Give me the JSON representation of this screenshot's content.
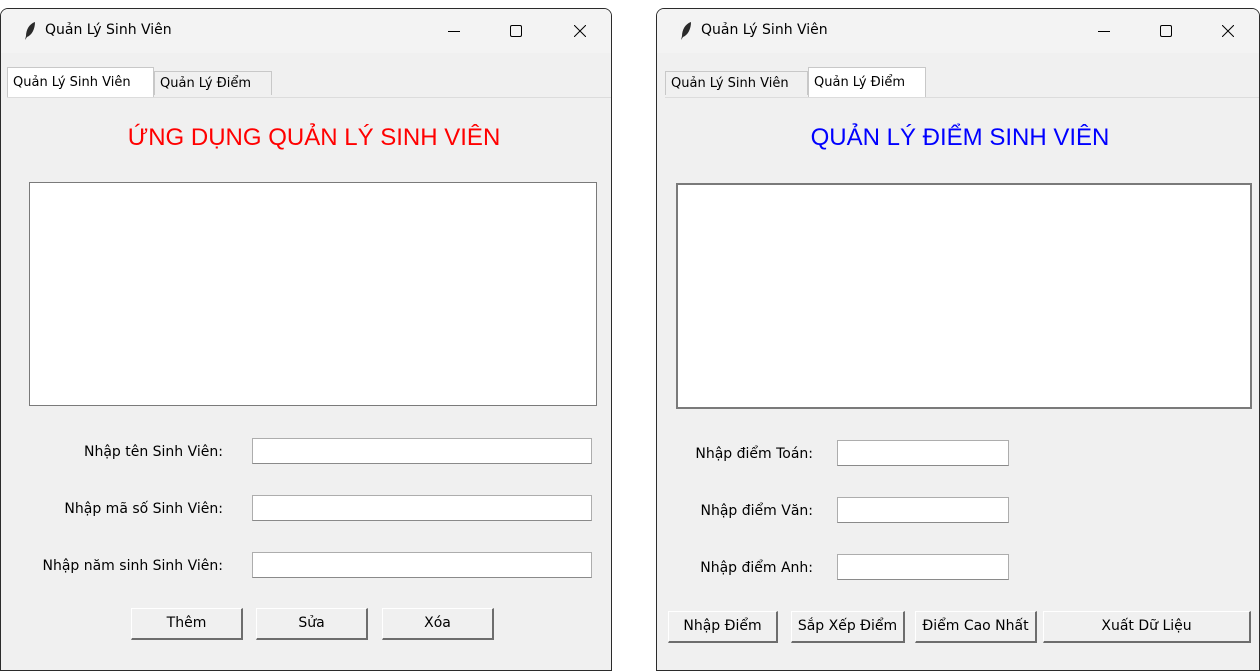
{
  "windows": [
    {
      "title": "Quản Lý Sinh Viên",
      "tabs": [
        "Quản Lý Sinh Viên",
        "Quản Lý Điểm"
      ],
      "active_tab": 0,
      "heading": "ỨNG DỤNG QUẢN LÝ SINH VIÊN",
      "heading_color": "#ff0000",
      "fields": [
        {
          "label": "Nhập tên Sinh Viên:",
          "value": ""
        },
        {
          "label": "Nhập mã số Sinh Viên:",
          "value": ""
        },
        {
          "label": "Nhập năm sinh Sinh Viên:",
          "value": ""
        }
      ],
      "buttons": [
        "Thêm",
        "Sửa",
        "Xóa"
      ]
    },
    {
      "title": "Quản Lý Sinh Viên",
      "tabs": [
        "Quản Lý Sinh Viên",
        "Quản Lý Điểm"
      ],
      "active_tab": 1,
      "heading": "QUẢN LÝ ĐIỂM SINH VIÊN",
      "heading_color": "#0000ff",
      "fields": [
        {
          "label": "Nhập điểm Toán:",
          "value": ""
        },
        {
          "label": "Nhập điểm Văn:",
          "value": ""
        },
        {
          "label": "Nhập điểm Anh:",
          "value": ""
        }
      ],
      "buttons": [
        "Nhập Điểm",
        "Sắp Xếp Điểm",
        "Điểm Cao Nhất",
        "Xuất Dữ Liệu"
      ]
    }
  ],
  "window_controls": [
    "minimize-icon",
    "maximize-icon",
    "close-icon"
  ]
}
